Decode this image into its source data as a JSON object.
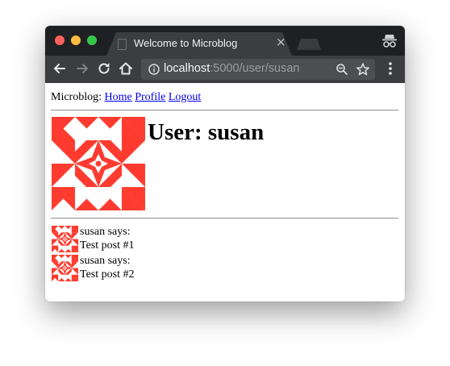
{
  "browser": {
    "tab_title": "Welcome to Microblog",
    "tab_close": "×",
    "url_host": "localhost",
    "url_path": ":5000/user/susan",
    "icons": [
      "back-icon",
      "forward-icon",
      "reload-icon",
      "home-icon",
      "info-icon",
      "zoom-icon",
      "bookmark-star-icon",
      "menu-icon",
      "incognito-icon"
    ]
  },
  "nav": {
    "brand": "Microblog:",
    "links": [
      "Home",
      "Profile",
      "Logout"
    ]
  },
  "profile": {
    "heading": "User: susan",
    "avatar_color": "#ff3b30"
  },
  "posts": [
    {
      "author_line": "susan says:",
      "body": "Test post #1"
    },
    {
      "author_line": "susan says:",
      "body": "Test post #2"
    }
  ]
}
